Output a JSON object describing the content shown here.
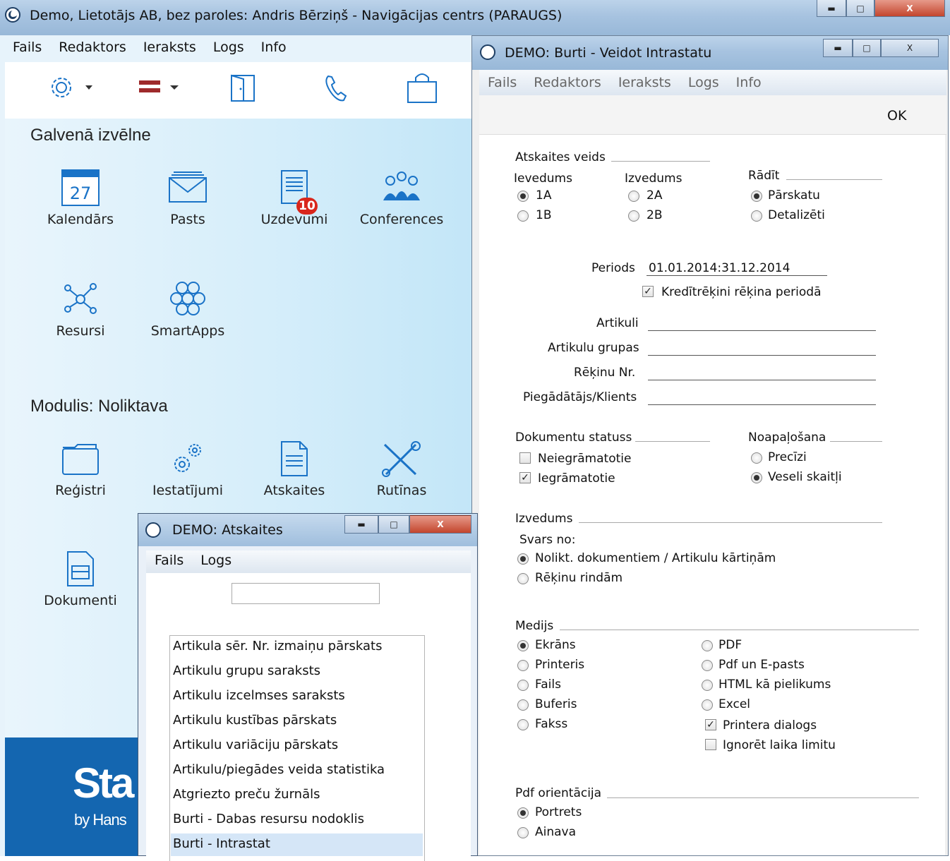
{
  "main_window": {
    "title": "Demo, Lietotājs AB, bez paroles: Andris Bērziņš - Navigācijas centrs (PARAUGS)",
    "menu": [
      "Fails",
      "Redaktors",
      "Ieraksts",
      "Logs",
      "Info"
    ],
    "section_main": "Galvenā izvēlne",
    "main_tiles": {
      "calendar": "Kalendārs",
      "calendar_day": "27",
      "mail": "Pasts",
      "tasks": "Uzdevumi",
      "tasks_badge": "10",
      "conferences": "Conferences",
      "resources": "Resursi",
      "smartapps": "SmartApps"
    },
    "section_module": "Modulis:  Noliktava",
    "module_tiles": {
      "registers": "Reģistri",
      "settings": "Iestatījumi",
      "reports": "Atskaites",
      "routines": "Rutīnas",
      "documents": "Dokumenti"
    },
    "logo_text": "Sta",
    "logo_sub": "by Hans"
  },
  "intrastat": {
    "title": "DEMO: Burti - Veidot Intrastatu",
    "menu": [
      "Fails",
      "Redaktors",
      "Ieraksts",
      "Logs",
      "Info"
    ],
    "ok": "OK",
    "report_type": "Atskaites veids",
    "import_label": "Ievedums",
    "import_1a": "1A",
    "import_1b": "1B",
    "export_label": "Izvedums",
    "export_2a": "2A",
    "export_2b": "2B",
    "show_label": "Rādīt",
    "show_overview": "Pārskatu",
    "show_detailed": "Detalizēti",
    "period_label": "Periods",
    "period_value": "01.01.2014:31.12.2014",
    "credit_notes": "Kredītrēķini rēķina periodā",
    "items_label": "Artikuli",
    "item_groups_label": "Artikulu grupas",
    "invoice_no_label": "Rēķinu Nr.",
    "supplier_label": "Piegādātājs/Klients",
    "doc_status": "Dokumentu statuss",
    "unregistered": "Neiegrāmatotie",
    "registered": "Iegrāmatotie",
    "rounding": "Noapaļošana",
    "exact": "Precīzi",
    "integers": "Veseli skaitļi",
    "output_section": "Izvedums",
    "weight_from": "Svars no:",
    "weight_docs": "Nolikt. dokumentiem / Artikulu kārtiņām",
    "weight_invoices": "Rēķinu rindām",
    "media": "Medijs",
    "media_left": [
      "Ekrāns",
      "Printeris",
      "Fails",
      "Buferis",
      "Fakss"
    ],
    "media_right": [
      "PDF",
      "Pdf un E-pasts",
      "HTML kā pielikums",
      "Excel"
    ],
    "printer_dialog": "Printera dialogs",
    "ignore_time": "Ignorēt laika limitu",
    "pdf_orientation": "Pdf orientācija",
    "portrait": "Portrets",
    "landscape": "Ainava"
  },
  "reports_window": {
    "title": "DEMO: Atskaites",
    "menu": [
      "Fails",
      "Logs"
    ],
    "search_value": "",
    "items": [
      "Artikula sēr. Nr. izmaiņu pārskats",
      "Artikulu grupu saraksts",
      "Artikulu izcelmses saraksts",
      "Artikulu kustības pārskats",
      "Artikulu variāciju pārskats",
      "Artikulu/piegādes veida statistika",
      "Atgriezto preču žurnāls",
      "Burti - Dabas resursu nodoklis",
      "Burti - Intrastat"
    ],
    "selected_index": 8
  },
  "colors": {
    "accent": "#1a73c7",
    "badge": "#d9261c",
    "selected_row": "#d5e6f7",
    "logo_bg": "#1466b0"
  }
}
